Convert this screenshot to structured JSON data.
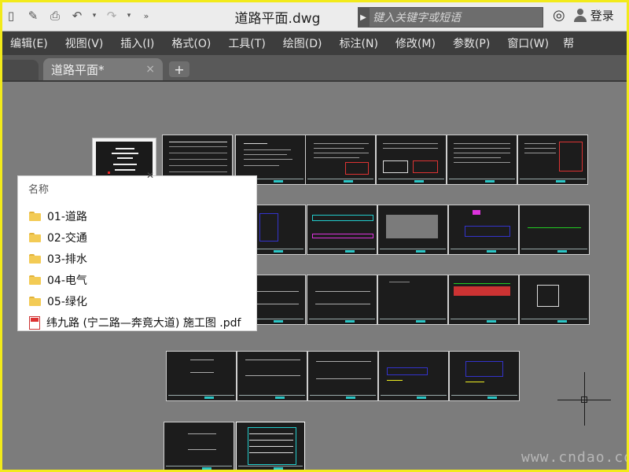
{
  "titlebar": {
    "document_title": "道路平面.dwg",
    "search_placeholder": "键入关键字或短语",
    "login_label": "登录"
  },
  "menu": {
    "items": [
      "编辑(E)",
      "视图(V)",
      "插入(I)",
      "格式(O)",
      "工具(T)",
      "绘图(D)",
      "标注(N)",
      "修改(M)",
      "参数(P)",
      "窗口(W)",
      "帮"
    ]
  },
  "tabs": {
    "active_label": "道路平面*",
    "close_glyph": "×",
    "add_glyph": "+"
  },
  "explorer": {
    "header": "名称",
    "items": [
      {
        "name": "01-道路",
        "type": "folder"
      },
      {
        "name": "02-交通",
        "type": "folder"
      },
      {
        "name": "03-排水",
        "type": "folder"
      },
      {
        "name": "04-电气",
        "type": "folder"
      },
      {
        "name": "05-绿化",
        "type": "folder"
      },
      {
        "name": "纬九路 (宁二路—奔竟大道) 施工图 .pdf",
        "type": "pdf"
      }
    ]
  },
  "canvas": {
    "watermark": "www.cndao.com"
  },
  "colors": {
    "frame": "#f2ea1a",
    "menu_bg": "#3d3d3d",
    "canvas_bg": "#7c7c7c",
    "folder": "#f3cb55"
  },
  "icons": [
    "undo-icon",
    "redo-icon",
    "save-icon",
    "print-icon",
    "binoculars-icon",
    "user-icon",
    "folder-icon",
    "pdf-icon"
  ]
}
